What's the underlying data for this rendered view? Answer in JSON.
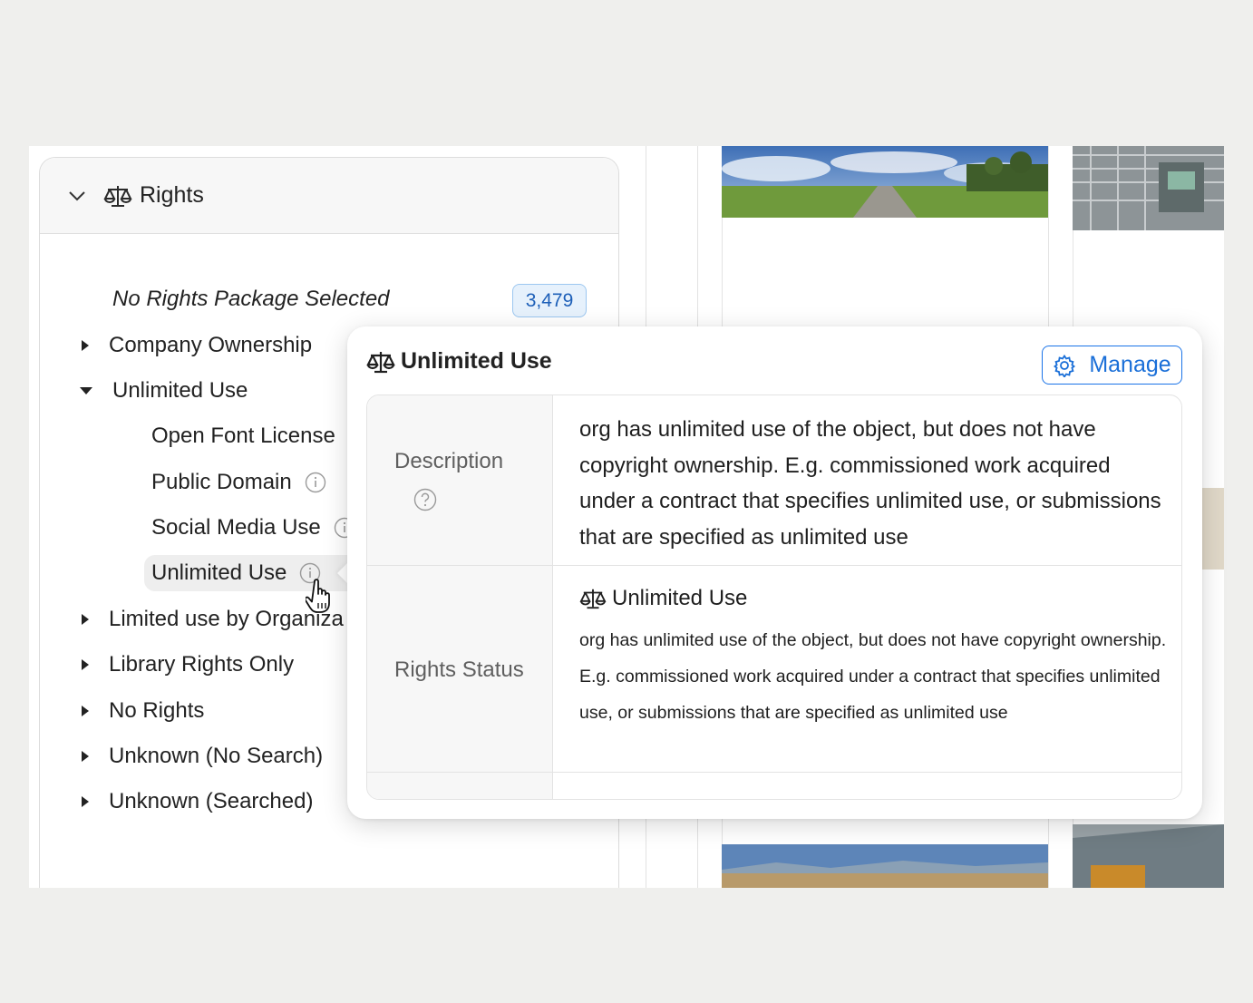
{
  "panel": {
    "title": "Rights",
    "no_package_label": "No Rights Package Selected",
    "no_package_count": "3,479",
    "items": [
      {
        "label": "Company Ownership",
        "expanded": false
      },
      {
        "label": "Unlimited Use",
        "expanded": true,
        "children": [
          {
            "label": "Open Font License"
          },
          {
            "label": "Public Domain"
          },
          {
            "label": "Social Media Use"
          },
          {
            "label": "Unlimited Use"
          }
        ]
      },
      {
        "label": "Limited use by Organiza",
        "expanded": false
      },
      {
        "label": "Library Rights Only",
        "expanded": false
      },
      {
        "label": "No Rights",
        "expanded": false
      },
      {
        "label": "Unknown (No Search)",
        "expanded": false
      },
      {
        "label": "Unknown (Searched)",
        "expanded": false
      }
    ]
  },
  "popover": {
    "title": "Unlimited Use",
    "manage_label": "Manage",
    "description_label": "Description",
    "description_text": "org has unlimited use of the object, but does not have copyright ownership. E.g. commissioned work acquired under a contract that specifies unlimited use, or submissions that are specified as unlimited use",
    "rights_status_label": "Rights Status",
    "rights_status_title": "Unlimited Use",
    "rights_status_text": "org has unlimited use of the object, but does not have copyright ownership. E.g. commissioned work acquired under a contract that specifies unlimited use, or submissions that are specified as unlimited use"
  },
  "colors": {
    "accent": "#1a73e8",
    "badge_bg": "#e6f1fc",
    "badge_border": "#9cc7f0",
    "page_bg": "#efefed"
  }
}
